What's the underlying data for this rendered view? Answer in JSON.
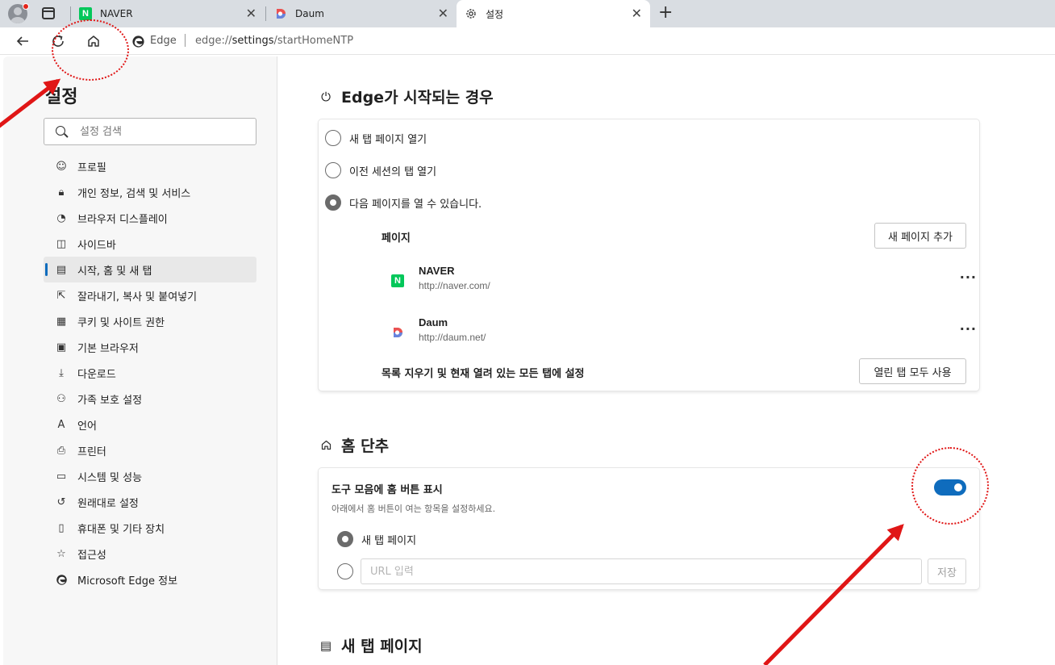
{
  "browser": {
    "tabs": [
      {
        "title": "NAVER",
        "favicon": "naver-favicon",
        "active": false
      },
      {
        "title": "Daum",
        "favicon": "daum-favicon",
        "active": false
      },
      {
        "title": "설정",
        "favicon": "gear-icon",
        "active": true
      }
    ],
    "address": {
      "site_label": "Edge",
      "url_prefix": "edge://",
      "url_host": "settings",
      "url_path": "/startHomeNTP"
    }
  },
  "sidebar": {
    "title": "설정",
    "search_placeholder": "설정 검색",
    "items": [
      {
        "label": "프로필",
        "icon": "profile-icon"
      },
      {
        "label": "개인 정보, 검색 및 서비스",
        "icon": "lock-icon"
      },
      {
        "label": "브라우저 디스플레이",
        "icon": "palette-icon"
      },
      {
        "label": "사이드바",
        "icon": "sidebar-icon"
      },
      {
        "label": "시작, 홈 및 새 탭",
        "icon": "home-tab-icon",
        "active": true
      },
      {
        "label": "잘라내기, 복사 및 붙여넣기",
        "icon": "share-icon"
      },
      {
        "label": "쿠키 및 사이트 권한",
        "icon": "cookie-icon"
      },
      {
        "label": "기본 브라우저",
        "icon": "browser-icon"
      },
      {
        "label": "다운로드",
        "icon": "download-icon"
      },
      {
        "label": "가족 보호 설정",
        "icon": "family-icon"
      },
      {
        "label": "언어",
        "icon": "language-icon"
      },
      {
        "label": "프린터",
        "icon": "printer-icon"
      },
      {
        "label": "시스템 및 성능",
        "icon": "laptop-icon"
      },
      {
        "label": "원래대로 설정",
        "icon": "reset-icon"
      },
      {
        "label": "휴대폰 및 기타 장치",
        "icon": "phone-icon"
      },
      {
        "label": "접근성",
        "icon": "accessibility-icon"
      },
      {
        "label": "Microsoft Edge 정보",
        "icon": "edge-logo-icon"
      }
    ]
  },
  "startup": {
    "title": "Edge가 시작되는 경우",
    "options": [
      {
        "label": "새 탭 페이지 열기",
        "checked": false
      },
      {
        "label": "이전 세션의 탭 열기",
        "checked": false
      },
      {
        "label": "다음 페이지를 열 수 있습니다.",
        "checked": true
      }
    ],
    "pages_label": "페이지",
    "add_page_button": "새 페이지 추가",
    "pages": [
      {
        "name": "NAVER",
        "url": "http://naver.com/",
        "more": "···"
      },
      {
        "name": "Daum",
        "url": "http://daum.net/",
        "more": "···"
      }
    ],
    "clear_label": "목록 지우기 및 현재 열려 있는 모든 탭에 설정",
    "use_open_tabs_button": "열린 탭 모두 사용"
  },
  "home_button": {
    "title": "홈 단추",
    "toggle_label": "도구 모음에 홈 버튼 표시",
    "toggle_on": true,
    "description": "아래에서 홈 버튼이 여는 항목을 설정하세요.",
    "option_new_tab": "새 탭 페이지",
    "url_placeholder": "URL 입력",
    "save_button": "저장"
  },
  "new_tab_page": {
    "title": "새 탭 페이지"
  },
  "colors": {
    "accent": "#0f6cbd",
    "annotation": "#e01616"
  }
}
